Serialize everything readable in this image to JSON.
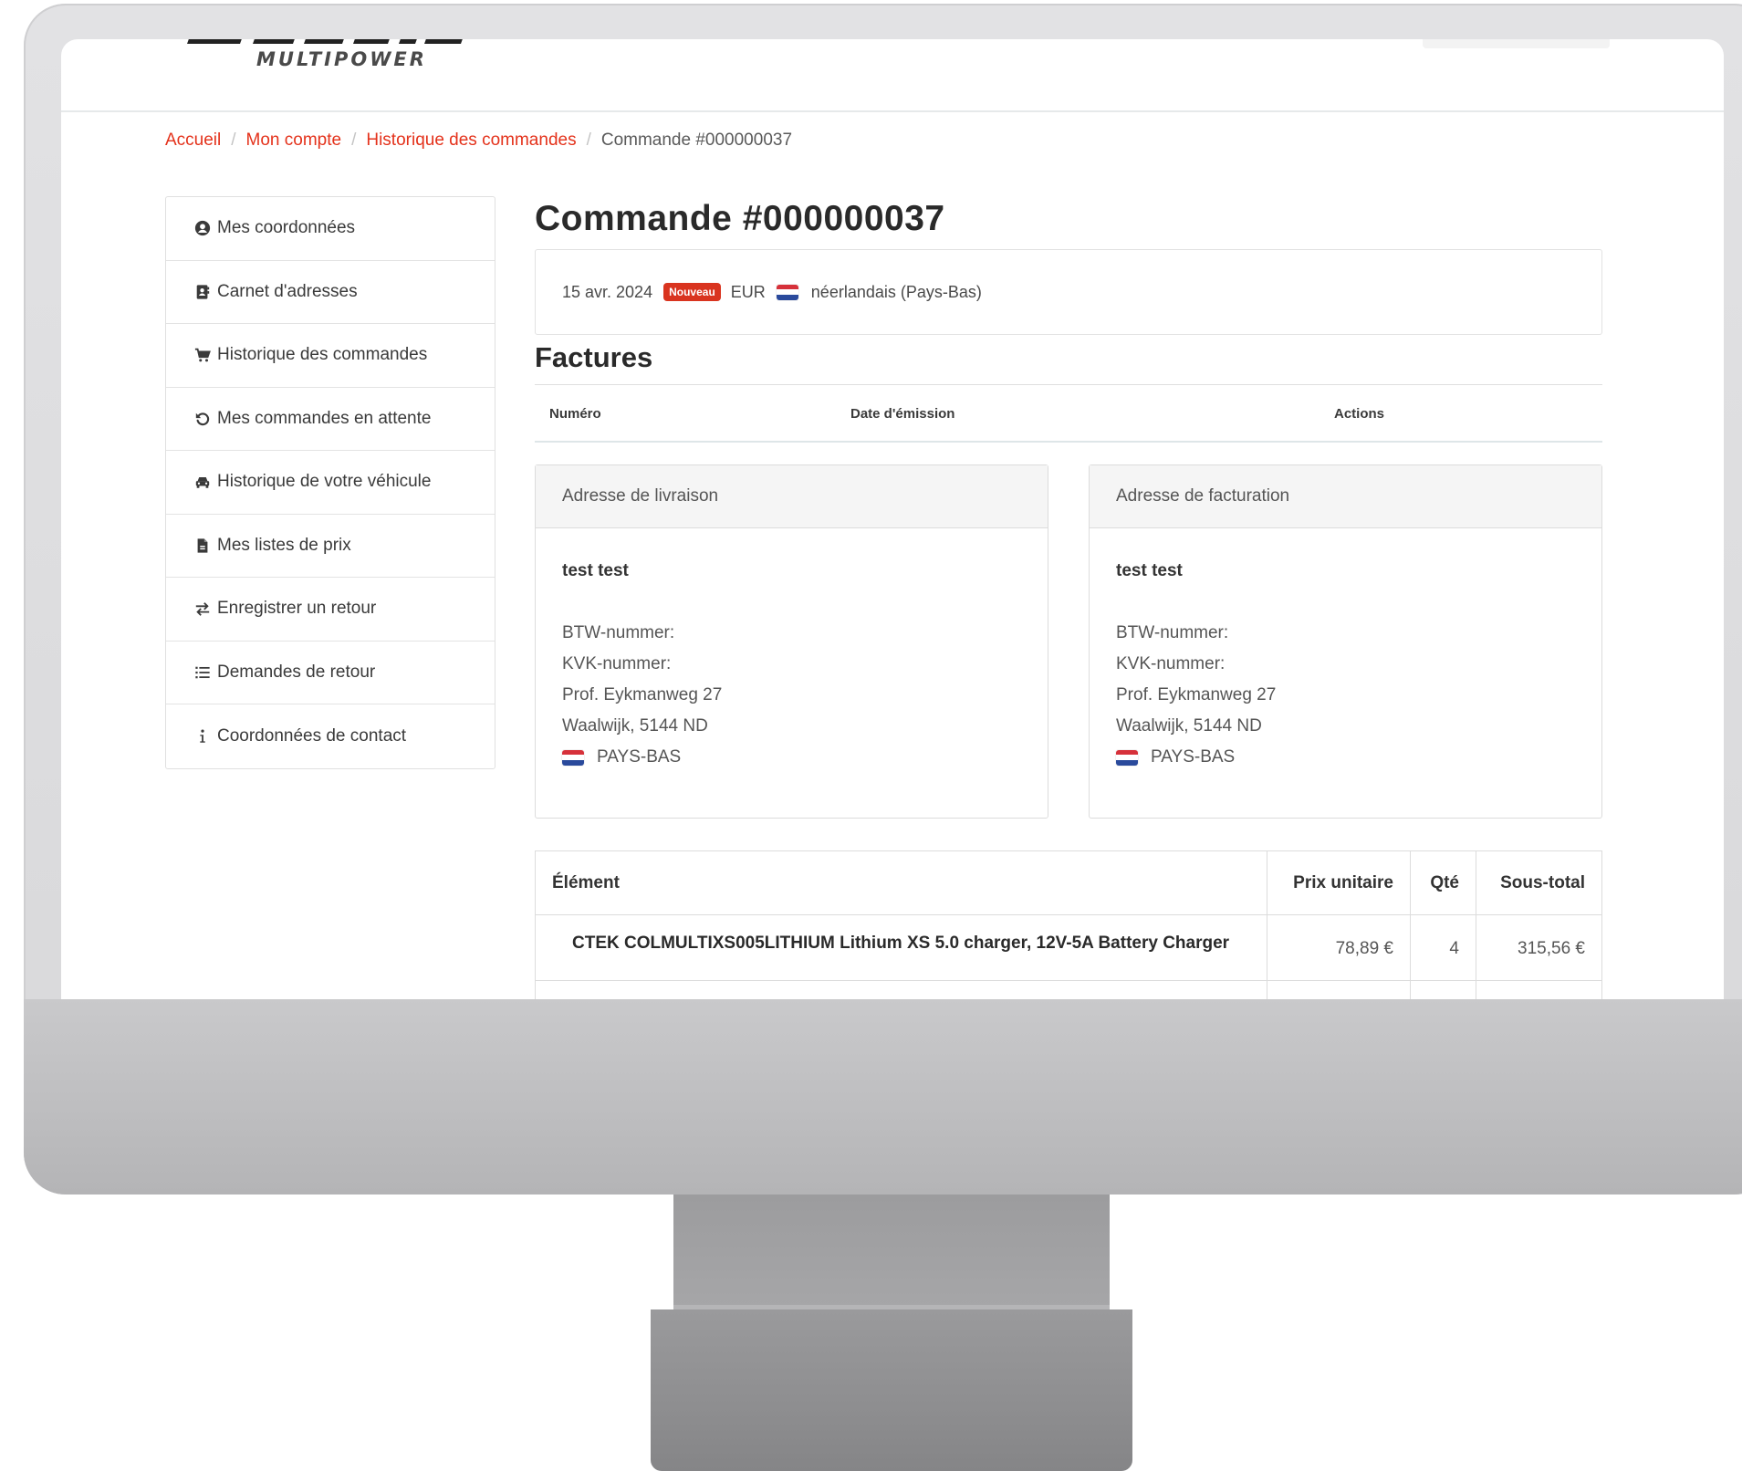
{
  "header": {
    "logo_sub": "MULTIPOWER"
  },
  "breadcrumb": {
    "items": [
      "Accueil",
      "Mon compte",
      "Historique des commandes"
    ],
    "current": "Commande #000000037",
    "separator": "/"
  },
  "sidebar": {
    "items": [
      {
        "label": "Mes coordonnées",
        "icon": "user-circle-icon"
      },
      {
        "label": "Carnet d'adresses",
        "icon": "address-book-icon"
      },
      {
        "label": "Historique des commandes",
        "icon": "cart-icon"
      },
      {
        "label": "Mes commandes en attente",
        "icon": "undo-icon"
      },
      {
        "label": "Historique de votre véhicule",
        "icon": "car-icon"
      },
      {
        "label": "Mes listes de prix",
        "icon": "file-icon"
      },
      {
        "label": "Enregistrer un retour",
        "icon": "exchange-icon"
      },
      {
        "label": "Demandes de retour",
        "icon": "list-icon"
      },
      {
        "label": "Coordonnées de contact",
        "icon": "info-icon"
      }
    ]
  },
  "order": {
    "title": "Commande #000000037",
    "date": "15 avr. 2024",
    "status_badge": "Nouveau",
    "currency": "EUR",
    "language": "néerlandais (Pays-Bas)"
  },
  "invoices": {
    "title": "Factures",
    "columns": [
      "Numéro",
      "Date d'émission",
      "Actions"
    ]
  },
  "shipping_address": {
    "title": "Adresse de livraison",
    "name": "test test",
    "btw": "BTW-nummer:",
    "kvk": "KVK-nummer:",
    "street": "Prof. Eykmanweg 27",
    "city": "Waalwijk, 5144 ND",
    "country": "PAYS-BAS"
  },
  "billing_address": {
    "title": "Adresse de facturation",
    "name": "test test",
    "btw": "BTW-nummer:",
    "kvk": "KVK-nummer:",
    "street": "Prof. Eykmanweg 27",
    "city": "Waalwijk, 5144 ND",
    "country": "PAYS-BAS"
  },
  "items": {
    "columns": {
      "element": "Élément",
      "unit_price": "Prix unitaire",
      "qty": "Qté",
      "subtotal": "Sous-total"
    },
    "rows": [
      {
        "name": "CTEK COLMULTIXS005LITHIUM Lithium XS 5.0 charger, 12V-5A Battery Charger",
        "unit_price": "78,89 €",
        "qty": "4",
        "subtotal": "315,56 €"
      }
    ]
  },
  "colors": {
    "accent": "#e4321b",
    "badge": "#d9341f",
    "monitor": "#dcdcde"
  }
}
